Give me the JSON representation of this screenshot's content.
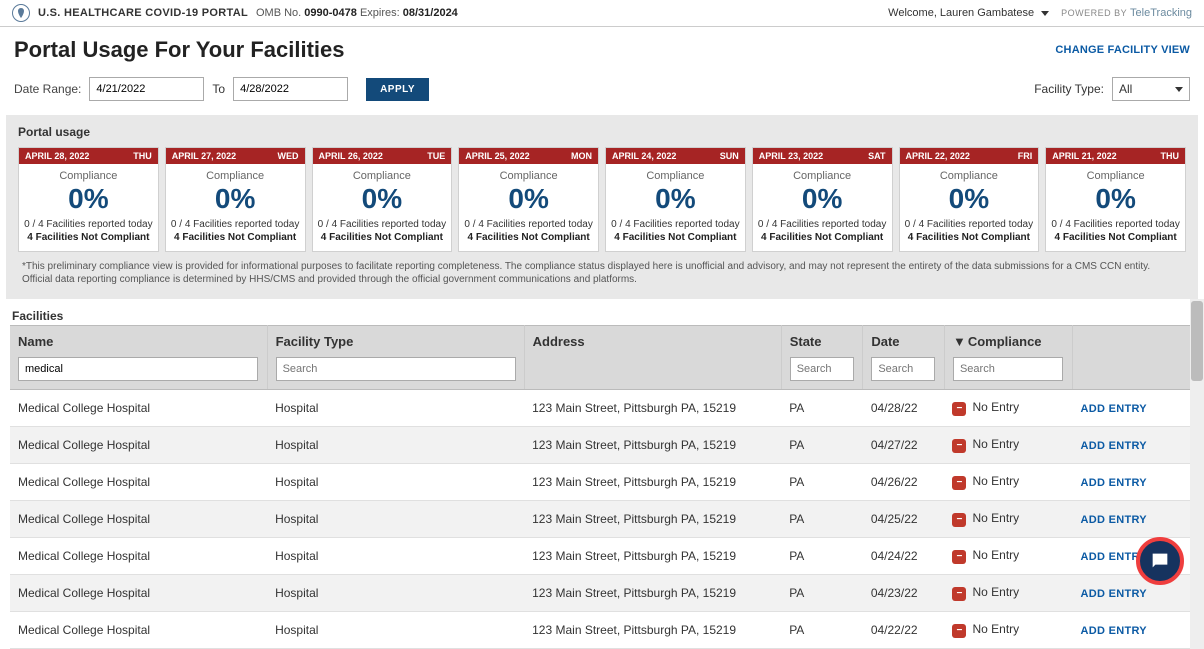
{
  "header": {
    "portal_name": "U.S. HEALTHCARE COVID-19 PORTAL",
    "omb_label": "OMB No.",
    "omb_no": "0990-0478",
    "expires_label": "Expires:",
    "expires": "08/31/2024",
    "welcome": "Welcome, Lauren Gambatese",
    "powered_label": "POWERED BY",
    "brand": "TeleTracking"
  },
  "page": {
    "title": "Portal Usage For Your Facilities",
    "change_view": "CHANGE FACILITY VIEW"
  },
  "filters": {
    "date_range_label": "Date Range:",
    "from": "4/21/2022",
    "to_label": "To",
    "to": "4/28/2022",
    "apply": "APPLY",
    "facility_type_label": "Facility Type:",
    "facility_type_value": "All"
  },
  "usage": {
    "section_label": "Portal usage",
    "cards": [
      {
        "date": "APRIL 28, 2022",
        "dow": "Thu",
        "comp_label": "Compliance",
        "comp_val": "0%",
        "reported": "0 / 4 Facilities reported today",
        "nc": "4 Facilities Not Compliant"
      },
      {
        "date": "APRIL 27, 2022",
        "dow": "Wed",
        "comp_label": "Compliance",
        "comp_val": "0%",
        "reported": "0 / 4 Facilities reported today",
        "nc": "4 Facilities Not Compliant"
      },
      {
        "date": "APRIL 26, 2022",
        "dow": "Tue",
        "comp_label": "Compliance",
        "comp_val": "0%",
        "reported": "0 / 4 Facilities reported today",
        "nc": "4 Facilities Not Compliant"
      },
      {
        "date": "APRIL 25, 2022",
        "dow": "Mon",
        "comp_label": "Compliance",
        "comp_val": "0%",
        "reported": "0 / 4 Facilities reported today",
        "nc": "4 Facilities Not Compliant"
      },
      {
        "date": "APRIL 24, 2022",
        "dow": "Sun",
        "comp_label": "Compliance",
        "comp_val": "0%",
        "reported": "0 / 4 Facilities reported today",
        "nc": "4 Facilities Not Compliant"
      },
      {
        "date": "APRIL 23, 2022",
        "dow": "Sat",
        "comp_label": "Compliance",
        "comp_val": "0%",
        "reported": "0 / 4 Facilities reported today",
        "nc": "4 Facilities Not Compliant"
      },
      {
        "date": "APRIL 22, 2022",
        "dow": "Fri",
        "comp_label": "Compliance",
        "comp_val": "0%",
        "reported": "0 / 4 Facilities reported today",
        "nc": "4 Facilities Not Compliant"
      },
      {
        "date": "APRIL 21, 2022",
        "dow": "Thu",
        "comp_label": "Compliance",
        "comp_val": "0%",
        "reported": "0 / 4 Facilities reported today",
        "nc": "4 Facilities Not Compliant"
      }
    ],
    "disclaimer": "*This preliminary compliance view is provided for informational purposes to facilitate reporting completeness. The compliance status displayed here is unofficial and advisory, and may not represent the entirety of the data submissions for a CMS CCN entity. Official data reporting compliance is determined by HHS/CMS and provided through the official government communications and platforms."
  },
  "facilities": {
    "section_label": "Facilities",
    "columns": {
      "name": "Name",
      "type": "Facility Type",
      "address": "Address",
      "state": "State",
      "date": "Date",
      "compliance": "Compliance"
    },
    "sort_icon": "▼",
    "search": {
      "name": "medical",
      "type_ph": "Search",
      "state_ph": "Search",
      "date_ph": "Search",
      "comp_ph": "Search"
    },
    "status_glyph": "−",
    "add_entry": "ADD ENTRY",
    "rows": [
      {
        "name": "Medical College Hospital",
        "type": "Hospital",
        "address": "123 Main Street, Pittsburgh PA, 15219",
        "state": "PA",
        "date": "04/28/22",
        "compliance": "No Entry"
      },
      {
        "name": "Medical College Hospital",
        "type": "Hospital",
        "address": "123 Main Street, Pittsburgh PA, 15219",
        "state": "PA",
        "date": "04/27/22",
        "compliance": "No Entry"
      },
      {
        "name": "Medical College Hospital",
        "type": "Hospital",
        "address": "123 Main Street, Pittsburgh PA, 15219",
        "state": "PA",
        "date": "04/26/22",
        "compliance": "No Entry"
      },
      {
        "name": "Medical College Hospital",
        "type": "Hospital",
        "address": "123 Main Street, Pittsburgh PA, 15219",
        "state": "PA",
        "date": "04/25/22",
        "compliance": "No Entry"
      },
      {
        "name": "Medical College Hospital",
        "type": "Hospital",
        "address": "123 Main Street, Pittsburgh PA, 15219",
        "state": "PA",
        "date": "04/24/22",
        "compliance": "No Entry"
      },
      {
        "name": "Medical College Hospital",
        "type": "Hospital",
        "address": "123 Main Street, Pittsburgh PA, 15219",
        "state": "PA",
        "date": "04/23/22",
        "compliance": "No Entry"
      },
      {
        "name": "Medical College Hospital",
        "type": "Hospital",
        "address": "123 Main Street, Pittsburgh PA, 15219",
        "state": "PA",
        "date": "04/22/22",
        "compliance": "No Entry"
      }
    ]
  }
}
